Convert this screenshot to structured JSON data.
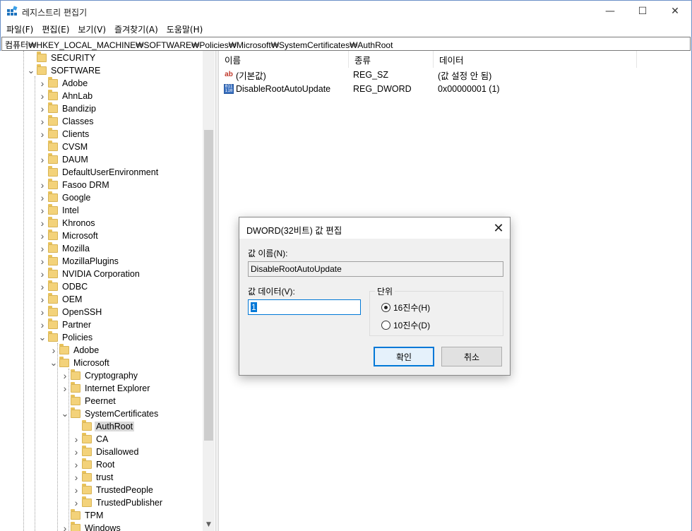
{
  "window": {
    "title": "레지스트리 편집기",
    "min_glyph": "—",
    "max_glyph": "☐",
    "close_glyph": "✕"
  },
  "menu": [
    "파일(F)",
    "편집(E)",
    "보기(V)",
    "즐겨찾기(A)",
    "도움말(H)"
  ],
  "address": "컴퓨터₩HKEY_LOCAL_MACHINE₩SOFTWARE₩Policies₩Microsoft₩SystemCertificates₩AuthRoot",
  "tree": {
    "items": [
      {
        "label": "SECURITY",
        "depth": 1,
        "chevron": ""
      },
      {
        "label": "SOFTWARE",
        "depth": 1,
        "chevron": "v"
      },
      {
        "label": "Adobe",
        "depth": 2,
        "chevron": ">"
      },
      {
        "label": "AhnLab",
        "depth": 2,
        "chevron": ">"
      },
      {
        "label": "Bandizip",
        "depth": 2,
        "chevron": ">"
      },
      {
        "label": "Classes",
        "depth": 2,
        "chevron": ">"
      },
      {
        "label": "Clients",
        "depth": 2,
        "chevron": ">"
      },
      {
        "label": "CVSM",
        "depth": 2,
        "chevron": ""
      },
      {
        "label": "DAUM",
        "depth": 2,
        "chevron": ">"
      },
      {
        "label": "DefaultUserEnvironment",
        "depth": 2,
        "chevron": ""
      },
      {
        "label": "Fasoo DRM",
        "depth": 2,
        "chevron": ">"
      },
      {
        "label": "Google",
        "depth": 2,
        "chevron": ">"
      },
      {
        "label": "Intel",
        "depth": 2,
        "chevron": ">"
      },
      {
        "label": "Khronos",
        "depth": 2,
        "chevron": ">"
      },
      {
        "label": "Microsoft",
        "depth": 2,
        "chevron": ">"
      },
      {
        "label": "Mozilla",
        "depth": 2,
        "chevron": ">"
      },
      {
        "label": "MozillaPlugins",
        "depth": 2,
        "chevron": ">"
      },
      {
        "label": "NVIDIA Corporation",
        "depth": 2,
        "chevron": ">"
      },
      {
        "label": "ODBC",
        "depth": 2,
        "chevron": ">"
      },
      {
        "label": "OEM",
        "depth": 2,
        "chevron": ">"
      },
      {
        "label": "OpenSSH",
        "depth": 2,
        "chevron": ">"
      },
      {
        "label": "Partner",
        "depth": 2,
        "chevron": ">"
      },
      {
        "label": "Policies",
        "depth": 2,
        "chevron": "v"
      },
      {
        "label": "Adobe",
        "depth": 3,
        "chevron": ">"
      },
      {
        "label": "Microsoft",
        "depth": 3,
        "chevron": "v"
      },
      {
        "label": "Cryptography",
        "depth": 4,
        "chevron": ">"
      },
      {
        "label": "Internet Explorer",
        "depth": 4,
        "chevron": ">"
      },
      {
        "label": "Peernet",
        "depth": 4,
        "chevron": ""
      },
      {
        "label": "SystemCertificates",
        "depth": 4,
        "chevron": "v"
      },
      {
        "label": "AuthRoot",
        "depth": 5,
        "chevron": "",
        "selected": true
      },
      {
        "label": "CA",
        "depth": 5,
        "chevron": ">"
      },
      {
        "label": "Disallowed",
        "depth": 5,
        "chevron": ">"
      },
      {
        "label": "Root",
        "depth": 5,
        "chevron": ">"
      },
      {
        "label": "trust",
        "depth": 5,
        "chevron": ">"
      },
      {
        "label": "TrustedPeople",
        "depth": 5,
        "chevron": ">"
      },
      {
        "label": "TrustedPublisher",
        "depth": 5,
        "chevron": ">"
      },
      {
        "label": "TPM",
        "depth": 4,
        "chevron": ""
      },
      {
        "label": "Windows",
        "depth": 4,
        "chevron": ">"
      }
    ]
  },
  "list": {
    "headers": [
      "이름",
      "종류",
      "데이터"
    ],
    "rows": [
      {
        "icon": "string-value-icon",
        "name": "(기본값)",
        "type": "REG_SZ",
        "data": "(값 설정 안 됨)"
      },
      {
        "icon": "dword-value-icon",
        "name": "DisableRootAutoUpdate",
        "type": "REG_DWORD",
        "data": "0x00000001 (1)"
      }
    ]
  },
  "dialog": {
    "title": "DWORD(32비트) 값 편집",
    "value_name_label": "값 이름(N):",
    "value_name": "DisableRootAutoUpdate",
    "value_data_label": "값 데이터(V):",
    "value_data": "1",
    "base_label": "단위",
    "radio_hex": "16진수(H)",
    "radio_dec": "10진수(D)",
    "ok": "확인",
    "cancel": "취소"
  }
}
